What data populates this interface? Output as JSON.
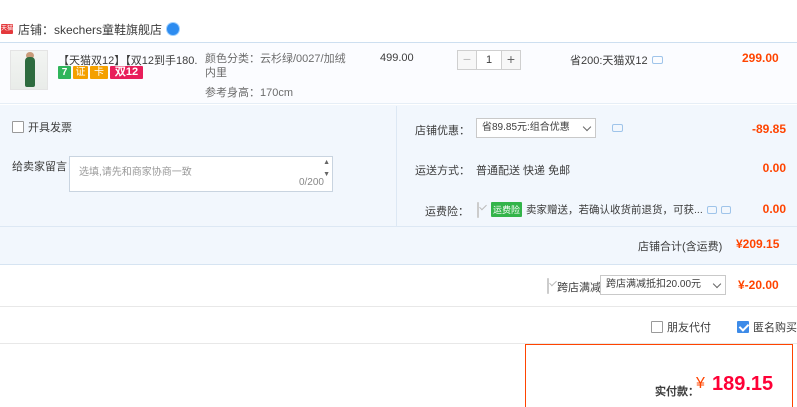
{
  "shop": {
    "badge_text": "天猫",
    "label": "店铺：skechers童鞋旗舰店",
    "icon": "wangwang-icon"
  },
  "item": {
    "title": "【天猫双12】【双12到手180...",
    "tags": [
      "7",
      "证",
      "卡",
      "双12"
    ],
    "attr_color": "颜色分类：云杉绿/0027/加绒内里",
    "attr_height": "参考身高：170cm",
    "unit_price": "499.00",
    "quantity": "1",
    "minus_label": "−",
    "plus_label": "+",
    "promo": "省200:天猫双12",
    "total": "299.00"
  },
  "options": {
    "invoice_label": "开具发票",
    "message_label": "给卖家留言：",
    "message_placeholder": "选填,请先和商家协商一致",
    "message_count": "0/200",
    "discount_label": "店铺优惠：",
    "discount_select": "省89.85元:组合优惠",
    "discount_amount": "-89.85",
    "shipping_label": "运送方式：",
    "shipping_method": "普通配送 快递 免邮",
    "shipping_amount": "0.00",
    "insurance_label": "运费险：",
    "insurance_badge": "运费险",
    "insurance_text": "卖家赠送，若确认收货前退货，可获...",
    "insurance_amount": "0.00"
  },
  "shop_total": {
    "label": "店铺合计(含运费)",
    "amount": "¥209.15"
  },
  "cross_store": {
    "label": "跨店满减",
    "select": "跨店满减抵扣20.00元",
    "amount": "¥-20.00"
  },
  "checkout": {
    "friend_pay": "朋友代付",
    "anonymous": "匿名购买",
    "pay_label": "实付款：",
    "currency": "¥",
    "pay_amount": "189.15"
  },
  "colors": {
    "accent_red": "#ff4400",
    "pay_red": "#ff0036",
    "panel_blue": "#f2f7fd",
    "check_blue": "#3d8be8"
  }
}
